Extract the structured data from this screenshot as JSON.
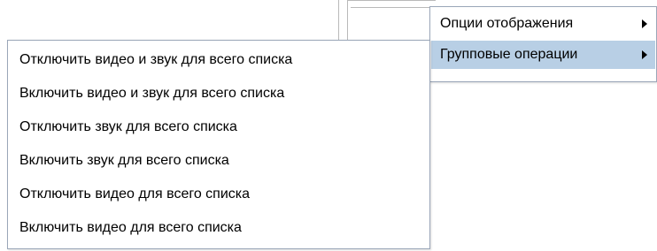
{
  "context_menu": {
    "items": [
      {
        "label": "Опции отображения",
        "has_submenu": true,
        "highlighted": false,
        "arrow_icon": "triangle-right-icon"
      },
      {
        "label": "Групповые операции",
        "has_submenu": true,
        "highlighted": true,
        "arrow_icon": "triangle-right-icon"
      }
    ]
  },
  "submenu": {
    "items": [
      {
        "label": "Отключить видео и звук для всего списка"
      },
      {
        "label": "Включить видео и звук для всего списка"
      },
      {
        "label": "Отключить звук для всего списка"
      },
      {
        "label": "Включить звук для всего списка"
      },
      {
        "label": "Отключить видео для всего списка"
      },
      {
        "label": "Включить видео для всего списка"
      }
    ]
  },
  "colors": {
    "highlight": "#b8cfe5",
    "border": "#9aa6b8",
    "background": "#ffffff",
    "text": "#000000"
  }
}
